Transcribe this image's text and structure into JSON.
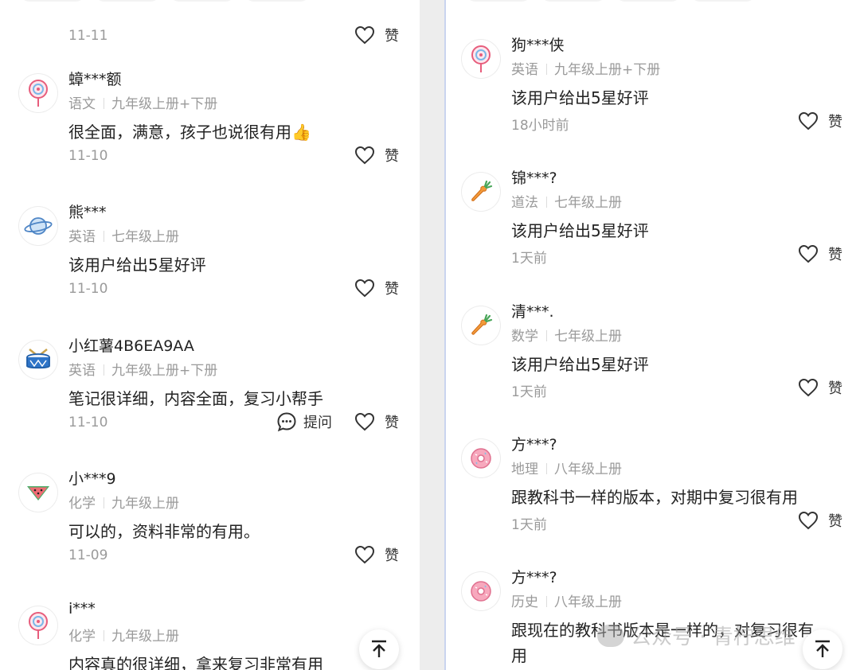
{
  "left": {
    "first_date": "11-11",
    "like_label": "赞",
    "ask_label": "提问",
    "reviews": [
      {
        "name": "蟑***额",
        "subject": "语文",
        "grade": "九年级上册+下册",
        "content": "很全面，满意，孩子也说很有用",
        "emoji": "👍",
        "date": "11-10",
        "avatar": "lollipop-icon"
      },
      {
        "name": "熊***",
        "subject": "英语",
        "grade": "七年级上册",
        "content": "该用户给出5星好评",
        "date": "11-10",
        "avatar": "planet-icon"
      },
      {
        "name": "小红薯4B6EA9AA",
        "subject": "英语",
        "grade": "九年级上册+下册",
        "content": "笔记很详细，内容全面，复习小帮手",
        "date": "11-10",
        "avatar": "drum-icon"
      },
      {
        "name": "小***9",
        "subject": "化学",
        "grade": "九年级上册",
        "content": "可以的，资料非常的有用。",
        "date": "11-09",
        "avatar": "watermelon-icon"
      },
      {
        "name": "i***",
        "subject": "化学",
        "grade": "九年级上册",
        "content": "内容真的很详细，拿来复习非常有用",
        "avatar": "lollipop-icon"
      }
    ]
  },
  "right": {
    "like_label": "赞",
    "reviews": [
      {
        "name": "狗***侠",
        "subject": "英语",
        "grade": "九年级上册+下册",
        "content": "该用户给出5星好评",
        "date": "18小时前",
        "avatar": "lollipop-icon"
      },
      {
        "name": "锦***?",
        "subject": "道法",
        "grade": "七年级上册",
        "content": "该用户给出5星好评",
        "date": "1天前",
        "avatar": "carrot-icon"
      },
      {
        "name": "清***.",
        "subject": "数学",
        "grade": "七年级上册",
        "content": "该用户给出5星好评",
        "date": "1天前",
        "avatar": "carrot-icon"
      },
      {
        "name": "方***?",
        "subject": "地理",
        "grade": "八年级上册",
        "content": "跟教科书一样的版本，对期中复习很有用",
        "date": "1天前",
        "avatar": "donut-icon"
      },
      {
        "name": "方***?",
        "subject": "历史",
        "grade": "八年级上册",
        "content": "跟现在的教科书版本是一样的，对复习很有",
        "content2": "用",
        "avatar": "donut-icon"
      }
    ]
  },
  "watermark": "公众号 · 青柠思维",
  "colors": {
    "heart_stroke": "#333333",
    "meta_gray": "#9a9a9a",
    "divider": "#c9d4ef"
  }
}
